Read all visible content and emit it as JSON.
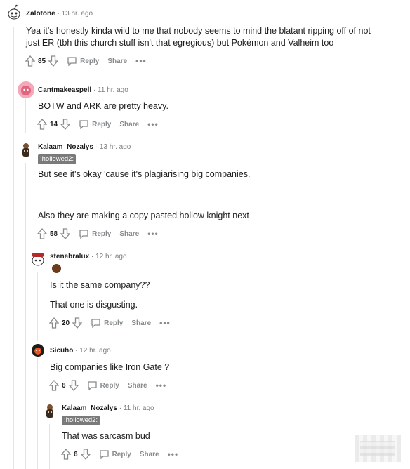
{
  "comments": [
    {
      "username": "Zalotone",
      "age": "13 hr. ago",
      "lines": [
        "Yea it's honestly kinda wild to me that nobody seems to mind the blatant ripping off of not",
        "just ER (tbh this church stuff isn't that egregious) but Pokémon and Valheim too"
      ],
      "votes": "85"
    },
    {
      "username": "Cantmakeaspell",
      "age": "11 hr. ago",
      "lines": [
        "BOTW and ARK are pretty heavy."
      ],
      "votes": "14"
    },
    {
      "username": "Kalaam_Nozalys",
      "age": "13 hr. ago",
      "flair": ":hollowed2:",
      "lines": [
        "But see it's okay 'cause it's plagiarising big companies.",
        "Also they are making a copy pasted hollow knight next"
      ],
      "votes": "58"
    },
    {
      "username": "stenebralux",
      "age": "12 hr. ago",
      "lines": [
        "Is it the same company??",
        "That one is disgusting."
      ],
      "votes": "20"
    },
    {
      "username": "Sicuho",
      "age": "12 hr. ago",
      "lines": [
        "Big companies like Iron Gate ?"
      ],
      "votes": "6"
    },
    {
      "username": "Kalaam_Nozalys",
      "age": "11 hr. ago",
      "flair": ":hollowed2:",
      "lines": [
        "That was sarcasm bud"
      ],
      "votes": "6"
    }
  ],
  "actions": {
    "reply": "Reply",
    "share": "Share",
    "more": "•••"
  },
  "separator": "·",
  "colors": {
    "text": "#1c1c1c",
    "meta": "#7c7c7c",
    "action": "#878a8c",
    "flair_bg": "#7a7a7a",
    "thread_line": "#e3e4e6"
  }
}
